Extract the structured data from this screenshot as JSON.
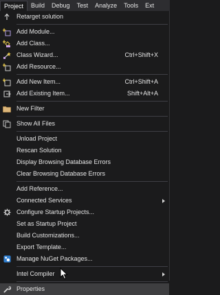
{
  "menubar": [
    "Project",
    "Build",
    "Debug",
    "Test",
    "Analyze",
    "Tools",
    "Ext"
  ],
  "menu": {
    "retarget": "Retarget solution",
    "add_module": "Add Module...",
    "add_class": "Add Class...",
    "class_wizard": "Class Wizard...",
    "class_wizard_sc": "Ctrl+Shift+X",
    "add_resource": "Add Resource...",
    "add_new_item": "Add New Item...",
    "add_new_item_sc": "Ctrl+Shift+A",
    "add_existing_item": "Add Existing Item...",
    "add_existing_item_sc": "Shift+Alt+A",
    "new_filter": "New Filter",
    "show_all_files": "Show All Files",
    "unload_project": "Unload Project",
    "rescan_solution": "Rescan Solution",
    "display_db_errors": "Display Browsing Database Errors",
    "clear_db_errors": "Clear Browsing Database Errors",
    "add_reference": "Add Reference...",
    "connected_services": "Connected Services",
    "configure_startup": "Configure Startup Projects...",
    "set_startup": "Set as Startup Project",
    "build_customizations": "Build Customizations...",
    "export_template": "Export Template...",
    "manage_nuget": "Manage NuGet Packages...",
    "intel_compiler": "Intel Compiler",
    "properties": "Properties"
  },
  "colors": {
    "background": "#1b1b1c",
    "menubar": "#2d2d30",
    "hover": "#3e3e40",
    "separator": "#3f3f46",
    "nuget_blue": "#2f7fd1"
  }
}
